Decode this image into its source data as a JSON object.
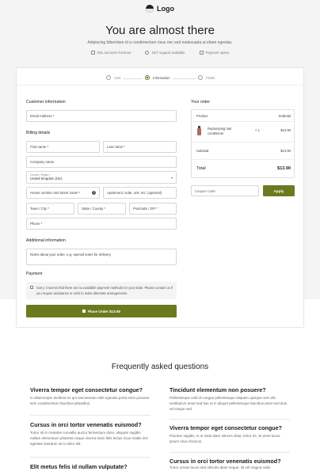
{
  "header": {
    "logo_text": "Logo",
    "title": "You are almost there",
    "subtitle": "Adipiscing bibendum id a condimentum risus nec sed malesuada ut etiam egestas.",
    "features": [
      {
        "icon": "lock-icon",
        "label": "SSL secured checkout"
      },
      {
        "icon": "support-icon",
        "label": "24/7 support available"
      },
      {
        "icon": "card-icon",
        "label": "Payment option"
      }
    ]
  },
  "steps": [
    {
      "label": "Cart",
      "active": false
    },
    {
      "label": "Information",
      "active": true
    },
    {
      "label": "Finish",
      "active": false
    }
  ],
  "customer": {
    "title": "Customer information",
    "email_placeholder": "Email Address *"
  },
  "billing": {
    "title": "Billing details",
    "first_name": "First name *",
    "last_name": "Last name *",
    "company": "Company name",
    "country_label": "Country / Region *",
    "country_value": "United Kingdom (UK)",
    "house": "House number and street name *",
    "apartment": "Apartment, suite, unit, etc. (optional)",
    "town": "Town / City *",
    "state": "State / County *",
    "postcode": "Postcode / ZIP *",
    "phone": "Phone *"
  },
  "additional": {
    "title": "Additional information",
    "notes_placeholder": "Notes about your order, e.g. special notes for delivery."
  },
  "payment": {
    "title": "Payment",
    "notice": "Sorry, it seems that there are no available payment methods for your state. Please contact us if you require assistance or wish to make alternate arrangements."
  },
  "place_order_label": "Place Order  $13.90",
  "order": {
    "title": "Your order",
    "col_product": "Product",
    "col_subtotal": "Subtotal",
    "item_name": "Replumping hair conditioner",
    "item_qty": "× 1",
    "item_price": "$13.90",
    "subtotal_label": "Subtotal",
    "subtotal_value": "$13.90",
    "total_label": "Total",
    "total_value": "$13.90",
    "coupon_placeholder": "Coupon Code",
    "apply_label": "Apply"
  },
  "faq": {
    "title": "Frequently asked questions",
    "items": [
      {
        "q": "Viverra tempor eget consectetur congue?",
        "a": "In ullamcorper eleifend mi qm sed aenean nibh egestas porta enim posuere sem condimentum faucibus phasellus."
      },
      {
        "q": "Tincidunt elementum non posuere?",
        "a": "Pellentesque volit id congue pellentesque aliquam quisque sem elit vestibulum amet sed hac et in aliquet pellentesque faucibus amet sed duis vel neque sed"
      },
      {
        "q": "Cursus in orci tortor venenatis euismod?",
        "a": "Tortor sit in molestie convallis auctor fermentum dolor, aliquam sagittis nullam elementum pharetra neque viverra enim felis lectus risus mattis nisl egestas interdum sit in dolor elit."
      },
      {
        "q": "Viverra tempor eget consectetur congue?",
        "a": "Pulvinar sagittis, in ut vitae diam ultrices vitae, tortor mi, sit amet lacus ipsum risus rhoncus."
      },
      {
        "q": "Elit metus felis id nullam vulputate?",
        "a": ""
      },
      {
        "q": "Cursus in orci tortor venenatis euismod?",
        "a": "Tortor ornare lacus sed ultricies diam neque, sit vel magna nulla"
      }
    ]
  }
}
